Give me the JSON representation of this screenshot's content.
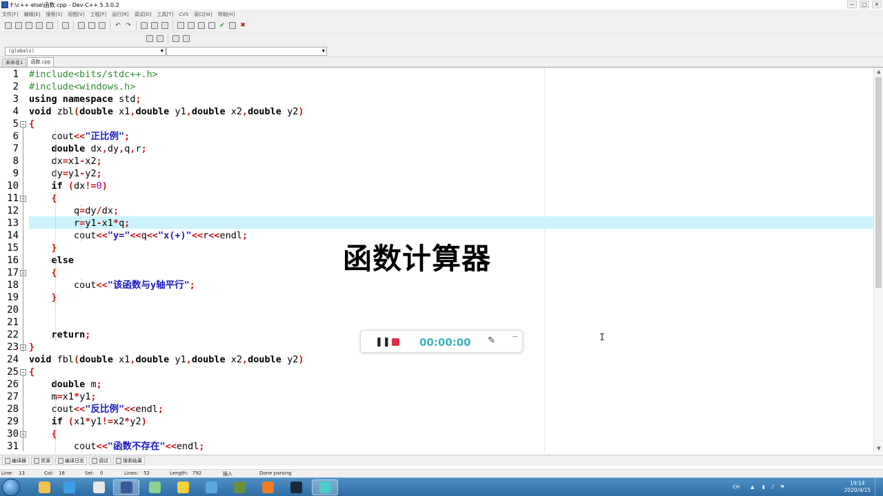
{
  "window": {
    "title": "F:\\c++ else\\函数.cpp - Dev-C++ 5.3.0.2",
    "controls": [
      "—",
      "□",
      "✕"
    ]
  },
  "menu": [
    "文件[F]",
    "编辑[E]",
    "搜索[S]",
    "视图[V]",
    "工程[P]",
    "运行[R]",
    "调试[D]",
    "工具[T]",
    "CVS",
    "窗口[W]",
    "帮助[H]"
  ],
  "combos": {
    "scope": "(globals)",
    "function": ""
  },
  "tabs": [
    "未命名1",
    "函数.cpp"
  ],
  "editor": {
    "lines": [
      {
        "n": "1",
        "code": "#include<bits/stdc++.h>"
      },
      {
        "n": "2",
        "code": "#include<windows.h>"
      },
      {
        "n": "3",
        "code": "using namespace std;"
      },
      {
        "n": "4",
        "code": "void zbl(double x1,double y1,double x2,double y2)"
      },
      {
        "n": "5",
        "code": "{"
      },
      {
        "n": "6",
        "code": "    cout<<\"正比例\";"
      },
      {
        "n": "7",
        "code": "    double dx,dy,q,r;"
      },
      {
        "n": "8",
        "code": "    dx=x1-x2;"
      },
      {
        "n": "9",
        "code": "    dy=y1-y2;"
      },
      {
        "n": "10",
        "code": "    if (dx!=0)"
      },
      {
        "n": "11",
        "code": "    {"
      },
      {
        "n": "12",
        "code": "        q=dy/dx;"
      },
      {
        "n": "13",
        "code": "        r=y1-x1*q;"
      },
      {
        "n": "14",
        "code": "        cout<<\"y=\"<<q<<\"x(+)\"<<r<<endl;"
      },
      {
        "n": "15",
        "code": "    }"
      },
      {
        "n": "16",
        "code": "    else"
      },
      {
        "n": "17",
        "code": "    {"
      },
      {
        "n": "18",
        "code": "        cout<<\"该函数与y轴平行\";"
      },
      {
        "n": "19",
        "code": "    }"
      },
      {
        "n": "20",
        "code": ""
      },
      {
        "n": "21",
        "code": ""
      },
      {
        "n": "22",
        "code": "    return;"
      },
      {
        "n": "23",
        "code": "}"
      },
      {
        "n": "24",
        "code": "void fbl(double x1,double y1,double x2,double y2)"
      },
      {
        "n": "25",
        "code": "{"
      },
      {
        "n": "26",
        "code": "    double m;"
      },
      {
        "n": "27",
        "code": "    m=x1*y1;"
      },
      {
        "n": "28",
        "code": "    cout<<\"反比例\"<<endl;"
      },
      {
        "n": "29",
        "code": "    if (x1*y1!=x2*y2)"
      },
      {
        "n": "30",
        "code": "    {"
      },
      {
        "n": "31",
        "code": "        cout<<\"函数不存在\"<<endl;"
      }
    ],
    "current_line": "13",
    "fold_markers": [
      "5",
      "11",
      "17",
      "23",
      "25",
      "30"
    ]
  },
  "overlay": {
    "title": "函数计算器"
  },
  "recorder": {
    "pause": "❚❚",
    "time": "00:00:00",
    "pen": "✎",
    "minimize": "−"
  },
  "bottom_tabs": [
    "编译器",
    "资源",
    "编译日志",
    "调试",
    "搜索结果"
  ],
  "status": {
    "line_label": "Line:",
    "line": "13",
    "col_label": "Col:",
    "col": "18",
    "sel_label": "Sel:",
    "sel": "0",
    "lines_label": "Lines:",
    "lines": "52",
    "length_label": "Length:",
    "length": "792",
    "mode": "插入",
    "message": "Done parsing"
  },
  "taskbar": {
    "items": [
      {
        "name": "folder",
        "color": "#f3c04a"
      },
      {
        "name": "ie",
        "color": "#3aa0e8"
      },
      {
        "name": "media",
        "color": "#e8e8e8"
      },
      {
        "name": "devcpp",
        "color": "#3b5998"
      },
      {
        "name": "notepad",
        "color": "#8fd18f"
      },
      {
        "name": "yellow-app",
        "color": "#f2d33b"
      },
      {
        "name": "circle-app",
        "color": "#5aa7e0"
      },
      {
        "name": "minecraft",
        "color": "#6b8f3a"
      },
      {
        "name": "firefox",
        "color": "#f07c2a"
      },
      {
        "name": "steam",
        "color": "#1b2838"
      },
      {
        "name": "recorder",
        "color": "#4fc9c9"
      }
    ],
    "tray": {
      "lang": "CH",
      "time": "19:14",
      "date": "2020/4/15"
    }
  }
}
